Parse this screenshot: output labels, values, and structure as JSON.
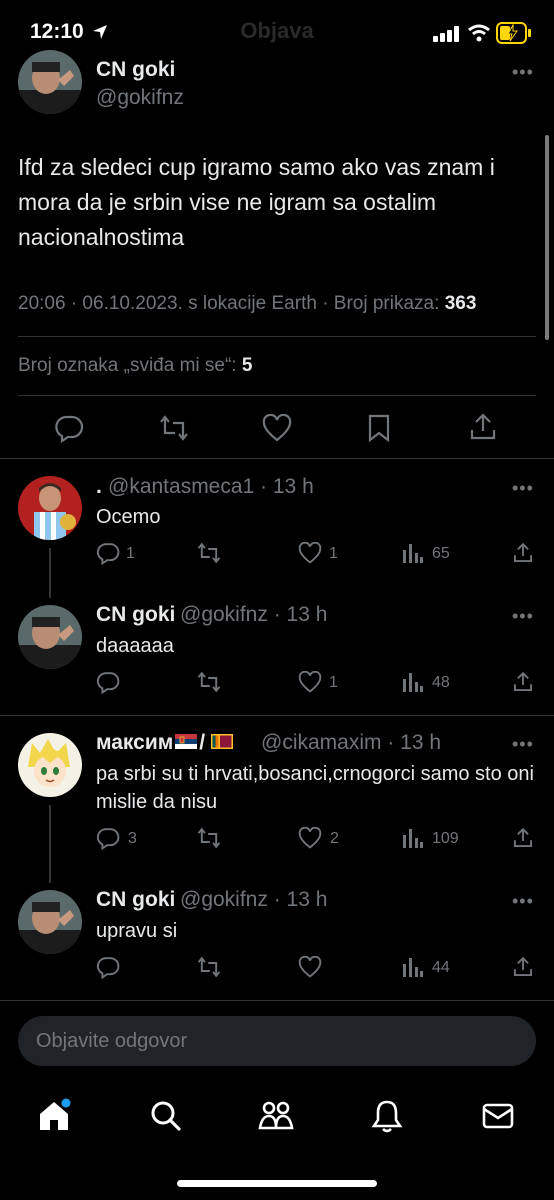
{
  "status_bar": {
    "time": "12:10",
    "title": "Objava"
  },
  "post": {
    "author_name": "CN goki",
    "author_handle": "@gokifnz",
    "text": "Ifd za sledeci cup igramo samo ako vas znam i mora da je srbin vise ne igram sa ostalim nacionalnostima",
    "meta_prefix": "20:06 · 06.10.2023. s lokacije Earth · Broj prikaza: ",
    "views": "363",
    "likes_label": "Broj oznaka „sviđa mi se“: ",
    "likes_count": "5",
    "more": "•••"
  },
  "replies": [
    {
      "name": ".",
      "handle": "@kantasmeca1 · 13 h",
      "text": "Ocemo",
      "reply_count": "1",
      "repost_count": "",
      "like_count": "1",
      "view_count": "65"
    },
    {
      "name": "CN goki",
      "handle": "@gokifnz · 13 h",
      "text": "daaaaaa",
      "reply_count": "",
      "repost_count": "",
      "like_count": "1",
      "view_count": "48"
    },
    {
      "name_prefix": "максим",
      "name_sep": "/",
      "handle": "@cikamaxim · 13 h",
      "text": "pa srbi su ti hrvati,bosanci,crnogorci samo sto oni mislie da nisu",
      "reply_count": "3",
      "repost_count": "",
      "like_count": "2",
      "view_count": "109"
    },
    {
      "name": "CN goki",
      "handle": "@gokifnz · 13 h",
      "text": "upravu si",
      "reply_count": "",
      "repost_count": "",
      "like_count": "",
      "view_count": "44"
    }
  ],
  "reply_input": {
    "placeholder": "Objavite odgovor"
  },
  "colors": {
    "background": "#000000",
    "text": "#e7e9ea",
    "muted": "#71767b",
    "accent": "#1d9bf0",
    "divider": "#2f3336"
  },
  "icons": [
    "home-icon",
    "search-icon",
    "communities-icon",
    "bell-icon",
    "mail-icon"
  ]
}
